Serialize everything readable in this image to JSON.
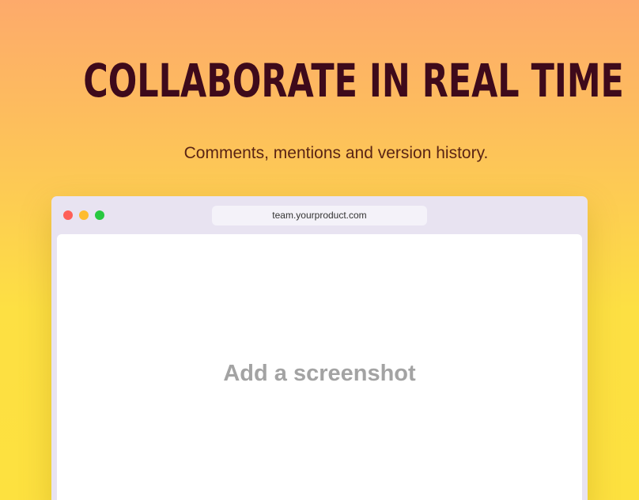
{
  "hero": {
    "headline": "COLLABORATE IN REAL TIME",
    "subtitle": "Comments, mentions and version history."
  },
  "browser": {
    "url": "team.yourproduct.com",
    "placeholder": "Add a screenshot",
    "traffic_lights": {
      "close_color": "#fe5f57",
      "minimize_color": "#febc2e",
      "maximize_color": "#28c840"
    }
  },
  "colors": {
    "headline": "#3e0a1b",
    "subtitle": "#5a2414",
    "background_top": "#fdaa6b",
    "background_bottom": "#fde13f",
    "browser_frame": "#e8e3f1"
  }
}
